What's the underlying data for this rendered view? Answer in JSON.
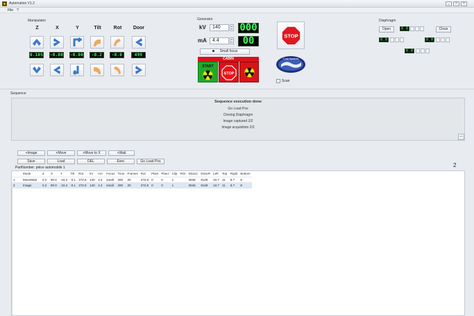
{
  "window": {
    "title": "Automation V1.2",
    "controls": [
      "_",
      "□",
      "×"
    ]
  },
  "menu": {
    "file": "File",
    "help": "?"
  },
  "manipulator": {
    "label": "Manipulator",
    "columns": [
      {
        "name": "Z",
        "value": "0.105"
      },
      {
        "name": "X",
        "value": "-0.00"
      },
      {
        "name": "Y",
        "value": "-0.00"
      },
      {
        "name": "Tilt",
        "value": "-0.2"
      },
      {
        "name": "Rot",
        "value": "-0.0"
      },
      {
        "name": "Door",
        "value": "499"
      }
    ]
  },
  "generator": {
    "label": "Generator",
    "kv_label": "kV",
    "kv_value": "140",
    "ma_label": "mA",
    "ma_value": "4.4",
    "kv_display": "000",
    "ma_display": "00",
    "focus_button": "Small focus",
    "cabin_label": "CABIN",
    "start_label": "START",
    "stop_label": "STOP"
  },
  "stop_button": {
    "label": "STOP"
  },
  "logo": {
    "text": "X-ray Systems"
  },
  "scan": {
    "label": "Scan",
    "checked": false
  },
  "diaphragm": {
    "label": "Diaphragm",
    "open_button": "Open",
    "close_button": "Close",
    "values": [
      "0.0",
      "0.0",
      "0.0",
      "0.0"
    ]
  },
  "sequence": {
    "label": "Sequence",
    "title": "Sequence execution done",
    "lines": [
      "Go Load Pos",
      "Closing Diaphragm",
      "Image captured 2/2",
      "Image acquisition 2/2"
    ],
    "collapse_icon": "—"
  },
  "toolbar": {
    "row1": [
      "+Image",
      "+Move",
      "+Move to X",
      "+Wait"
    ],
    "row2": [
      "Save",
      "Load",
      "DEL",
      "Exec",
      "Go Load Pos"
    ],
    "count": "2",
    "part_label": "PartNumber: pièce automobile 1"
  },
  "table": {
    "headers": [
      "",
      "Mode",
      "Z",
      "X",
      "Y",
      "Tilt",
      "Rot",
      "kV",
      "mA",
      "Focus",
      "Time",
      "Frames",
      "Rot",
      "PlanI",
      "PlanJ",
      "Clip",
      "ROI",
      "DiracC",
      "DiracR",
      "Left",
      "Top",
      "Right",
      "Bottom"
    ],
    "rows": [
      [
        "1",
        "MoveWait",
        "0.2",
        "80.0",
        "-16.2",
        "-0.1",
        "272.8",
        "140",
        "4.4",
        "small",
        "200",
        "20",
        "272.8",
        "0",
        "0",
        "1",
        "",
        "3546",
        "8128",
        "10.7",
        "11",
        "8.7",
        "8"
      ],
      [
        "2",
        "Image",
        "0.2",
        "80.0",
        "-16.2",
        "-0.1",
        "272.8",
        "140",
        "4.4",
        "small",
        "200",
        "20",
        "272.8",
        "0",
        "0",
        "1",
        "",
        "3546",
        "8128",
        "10.7",
        "11",
        "8.7",
        "8"
      ]
    ]
  },
  "colors": {
    "start": "#1faa2a",
    "stop_red": "#d8141a",
    "lcd_green": "#38ff58",
    "lcd_bg": "#050805"
  }
}
